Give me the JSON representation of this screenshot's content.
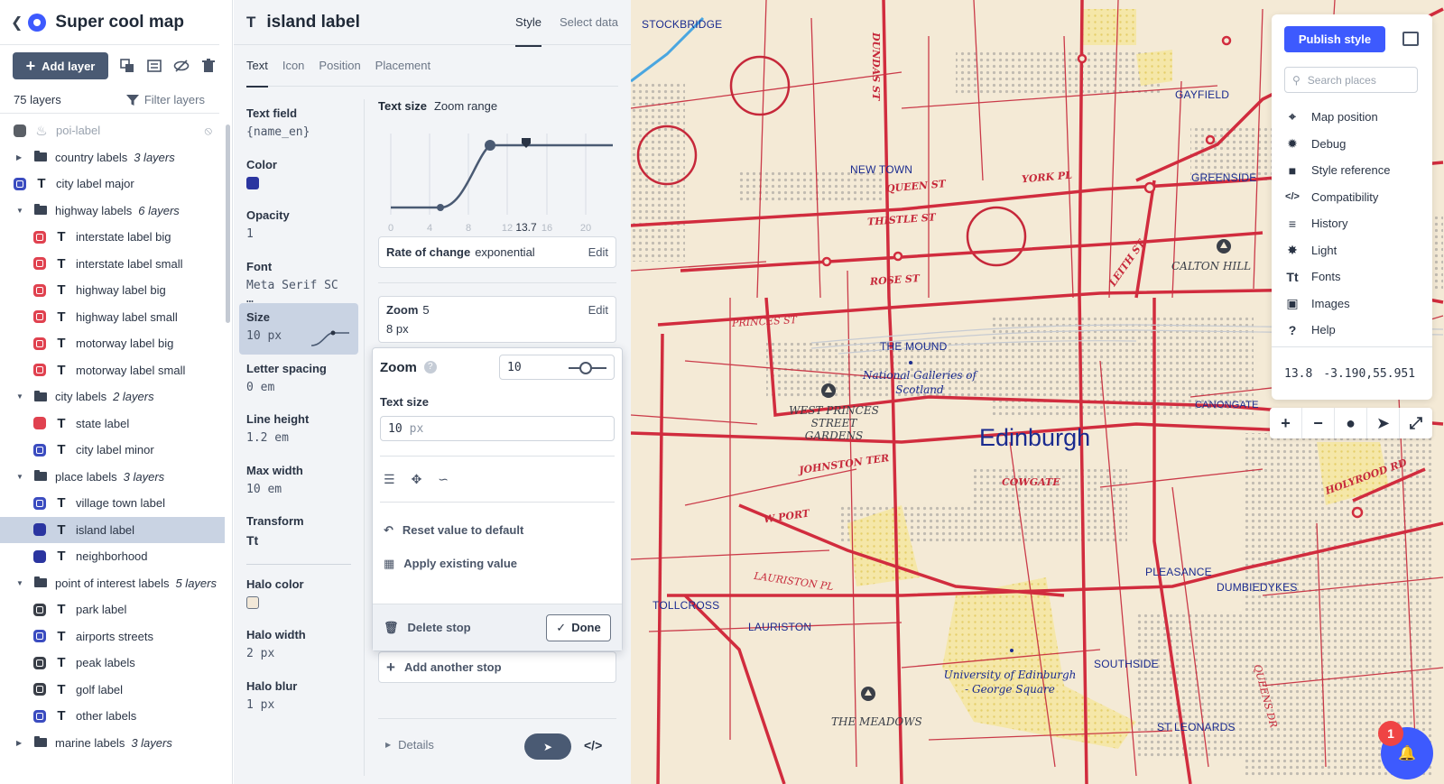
{
  "app": {
    "title": "Super cool map"
  },
  "left_toolbar": {
    "add_layer": "Add layer"
  },
  "layers_meta": {
    "count": "75 layers",
    "filter": "Filter layers"
  },
  "layers": [
    {
      "name": "poi-label",
      "kind": "layer",
      "swatch": "#5a5f66",
      "dim": true,
      "indent": 0,
      "icon": "fire-icon"
    },
    {
      "name": "country labels",
      "kind": "group",
      "count": "3 layers",
      "expanded": false
    },
    {
      "name": "city label major",
      "kind": "layer",
      "swatch": "#3b4cc0",
      "outline": true,
      "indent": 0
    },
    {
      "name": "highway labels",
      "kind": "group",
      "count": "6 layers",
      "expanded": true
    },
    {
      "name": "interstate label big",
      "kind": "layer",
      "swatch": "#e0414f",
      "outline": true,
      "indent": 1
    },
    {
      "name": "interstate label small",
      "kind": "layer",
      "swatch": "#e0414f",
      "outline": true,
      "indent": 1
    },
    {
      "name": "highway label big",
      "kind": "layer",
      "swatch": "#e0414f",
      "outline": true,
      "indent": 1
    },
    {
      "name": "highway label small",
      "kind": "layer",
      "swatch": "#e0414f",
      "outline": true,
      "indent": 1
    },
    {
      "name": "motorway label big",
      "kind": "layer",
      "swatch": "#e0414f",
      "outline": true,
      "indent": 1
    },
    {
      "name": "motorway label small",
      "kind": "layer",
      "swatch": "#e0414f",
      "outline": true,
      "indent": 1
    },
    {
      "name": "city labels",
      "kind": "group",
      "count": "2 layers",
      "expanded": true
    },
    {
      "name": "state label",
      "kind": "layer",
      "swatch": "#e0414f",
      "indent": 1
    },
    {
      "name": "city label minor",
      "kind": "layer",
      "swatch": "#3b4cc0",
      "outline": true,
      "indent": 1
    },
    {
      "name": "place labels",
      "kind": "group",
      "count": "3 layers",
      "expanded": true
    },
    {
      "name": "village town label",
      "kind": "layer",
      "swatch": "#3b4cc0",
      "outline": true,
      "indent": 1
    },
    {
      "name": "island label",
      "kind": "layer",
      "swatch": "#2b35a0",
      "indent": 1,
      "selected": true
    },
    {
      "name": "neighborhood",
      "kind": "layer",
      "swatch": "#2b35a0",
      "indent": 1
    },
    {
      "name": "point of interest labels",
      "kind": "group",
      "count": "5 layers",
      "expanded": true
    },
    {
      "name": "park label",
      "kind": "layer",
      "swatch": "#3a3f48",
      "outline": true,
      "indent": 1
    },
    {
      "name": "airports streets",
      "kind": "layer",
      "swatch": "#3b4cc0",
      "outline": true,
      "indent": 1
    },
    {
      "name": "peak labels",
      "kind": "layer",
      "swatch": "#3a3f48",
      "outline": true,
      "indent": 1
    },
    {
      "name": "golf label",
      "kind": "layer",
      "swatch": "#3a3f48",
      "outline": true,
      "indent": 1
    },
    {
      "name": "other labels",
      "kind": "layer",
      "swatch": "#3b4cc0",
      "outline": true,
      "indent": 1
    },
    {
      "name": "marine labels",
      "kind": "group",
      "count": "3 layers",
      "expanded": false
    }
  ],
  "style_panel": {
    "layer_title": "island label",
    "header_tabs": [
      "Style",
      "Select data"
    ],
    "sub_tabs": [
      "Text",
      "Icon",
      "Position",
      "Placement"
    ],
    "properties": [
      {
        "label": "Text field",
        "value": "{name_en}"
      },
      {
        "label": "Color",
        "color": "#2b35a0"
      },
      {
        "label": "Opacity",
        "value": "1"
      },
      {
        "label": "Font",
        "value": "Meta Serif SC …"
      },
      {
        "label": "Size",
        "value": "10 px",
        "selected": true
      },
      {
        "label": "Letter spacing",
        "value": "0 em"
      },
      {
        "label": "Line height",
        "value": "1.2 em"
      },
      {
        "label": "Max width",
        "value": "10 em"
      },
      {
        "label": "Transform",
        "value": "Tt"
      },
      {
        "label": "Halo color",
        "color": "#f2e8d8"
      },
      {
        "label": "Halo width",
        "value": "2 px"
      },
      {
        "label": "Halo blur",
        "value": "1 px"
      }
    ],
    "editor": {
      "title": "Text size",
      "mode": "Zoom range",
      "ticks": [
        "0",
        "4",
        "8",
        "12",
        "13.7",
        "16",
        "20"
      ],
      "rate_label": "Rate of change",
      "rate_value": "exponential",
      "edit": "Edit",
      "stop_label": "Zoom",
      "stop_zoom": "5",
      "stop_value": "8 px",
      "add_stop": "Add another stop",
      "details": "Details"
    },
    "zoom_popover": {
      "title": "Zoom",
      "zoom_value": "10",
      "text_size_label": "Text size",
      "text_size_value": "10",
      "text_size_unit": "px",
      "reset": "Reset value to default",
      "apply": "Apply existing value",
      "delete": "Delete stop",
      "done": "Done"
    }
  },
  "map": {
    "publish": "Publish style",
    "search_placeholder": "Search places",
    "menu": [
      {
        "label": "Map position",
        "icon": "crosshair-icon"
      },
      {
        "label": "Debug",
        "icon": "bug-icon"
      },
      {
        "label": "Style reference",
        "icon": "book-icon"
      },
      {
        "label": "Compatibility",
        "icon": "code-icon"
      },
      {
        "label": "History",
        "icon": "history-icon"
      },
      {
        "label": "Light",
        "icon": "light-icon"
      },
      {
        "label": "Fonts",
        "icon": "fonts-icon"
      },
      {
        "label": "Images",
        "icon": "image-icon"
      },
      {
        "label": "Help",
        "icon": "help-icon"
      }
    ],
    "zoom": "13.8",
    "coords": "-3.190,55.951",
    "notification_count": "1",
    "labels": {
      "city": "Edinburgh",
      "districts": [
        "STOCKBRIDGE",
        "NEW TOWN",
        "GAYFIELD",
        "GREENSIDE",
        "THE MOUND",
        "TOLLCROSS",
        "LAURISTON",
        "PLEASANCE",
        "DUMBIEDYKES",
        "SOUTHSIDE",
        "ST LEONARDS",
        "CANONGATE"
      ],
      "streets": [
        "DUNDAS ST",
        "QUEEN ST",
        "YORK PL",
        "THISTLE ST",
        "ROSE ST",
        "LEITH ST",
        "PRINCES ST",
        "JOHNSTON TER",
        "COWGATE",
        "W PORT",
        "LAURISTON PL",
        "HOLYROOD RD",
        "QUEENS DR"
      ],
      "pois": [
        "CALTON HILL",
        "WEST PRINCES STREET GARDENS",
        "THE MEADOWS"
      ],
      "poi_blue": [
        "National Galleries of Scotland",
        "University of Edinburgh - George Square"
      ]
    }
  }
}
